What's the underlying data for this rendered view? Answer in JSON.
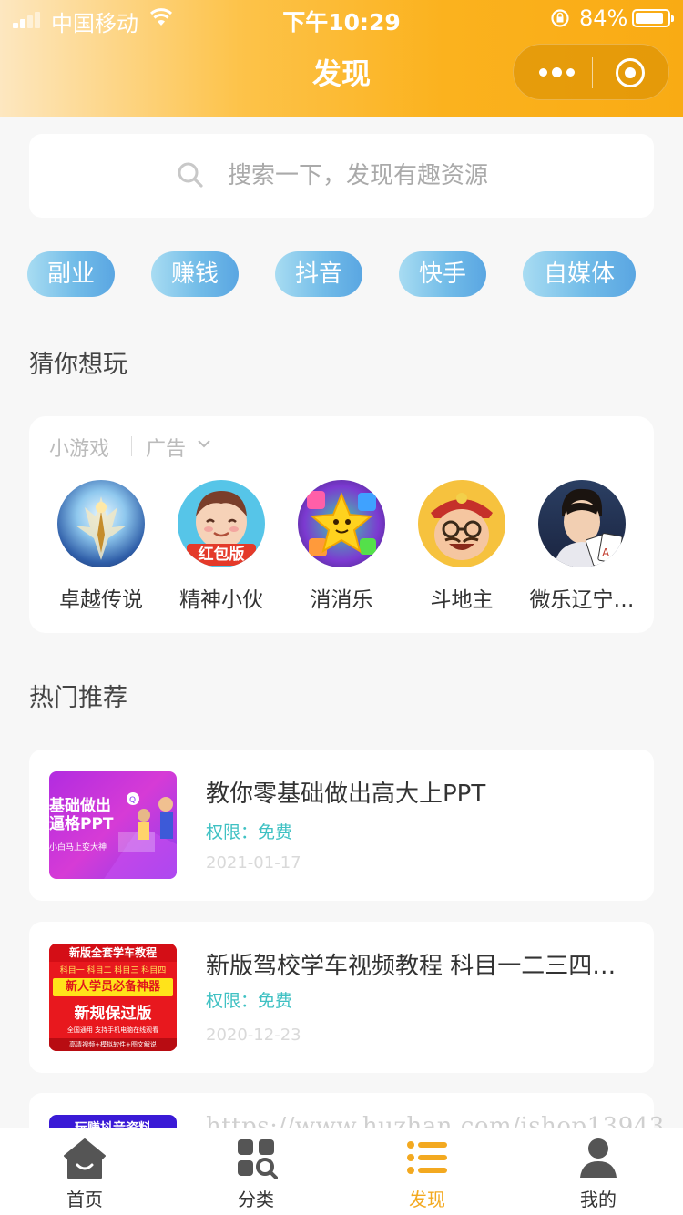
{
  "status_bar": {
    "carrier": "中国移动",
    "time": "下午10:29",
    "battery": "84%"
  },
  "header": {
    "title": "发现",
    "accent": "#fbb21e"
  },
  "search": {
    "placeholder": "搜索一下，发现有趣资源"
  },
  "tags": [
    "副业",
    "赚钱",
    "抖音",
    "快手",
    "自媒体"
  ],
  "guess_section": {
    "title": "猜你想玩",
    "tab_games": "小游戏",
    "tab_ads": "广告",
    "games": [
      {
        "name": "卓越传说",
        "icon": "legend-knight-icon"
      },
      {
        "name": "精神小伙",
        "icon": "cartoon-boy-icon",
        "badge": "红包版"
      },
      {
        "name": "消消乐",
        "icon": "gem-star-icon"
      },
      {
        "name": "斗地主",
        "icon": "landlord-face-icon"
      },
      {
        "name": "微乐辽宁…",
        "icon": "card-man-icon"
      }
    ]
  },
  "hot_section": {
    "title": "热门推荐",
    "items": [
      {
        "title": "教你零基础做出高大上PPT",
        "permission": "权限：免费",
        "date": "2021-01-17",
        "thumb_lines": [
          "基础做出",
          "逼格PPT",
          "小白马上变大神"
        ]
      },
      {
        "title": "新版驾校学车视频教程 科目一二三四…",
        "permission": "权限：免费",
        "date": "2020-12-23",
        "thumb_lines": [
          "新版全套学车教程",
          "科目一 科目二 科目三 科目四",
          "新人学员必备神器",
          "新规保过版",
          "全国通用 支持手机电脑在线观看",
          "高清视频+模拟软件+图文解说"
        ]
      },
      {
        "thumb_lines": [
          "玩赚抖音资料"
        ]
      }
    ]
  },
  "watermark": "https://www.huzhan.com/ishop13943",
  "tabbar": {
    "items": [
      {
        "label": "首页",
        "icon": "home-icon"
      },
      {
        "label": "分类",
        "icon": "category-icon"
      },
      {
        "label": "发现",
        "icon": "discover-list-icon",
        "active": true
      },
      {
        "label": "我的",
        "icon": "user-icon"
      }
    ],
    "active_color": "#f3a920"
  }
}
